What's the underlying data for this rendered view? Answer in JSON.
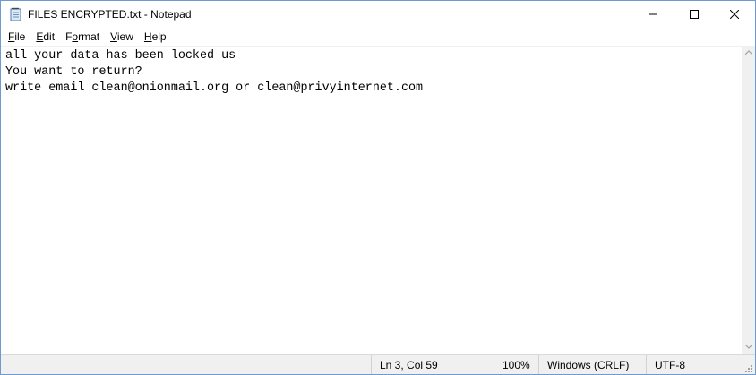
{
  "window": {
    "title": "FILES ENCRYPTED.txt - Notepad",
    "controls": {
      "minimize_icon": "minimize-icon",
      "maximize_icon": "maximize-icon",
      "close_icon": "close-icon"
    }
  },
  "menu": [
    {
      "accel": "F",
      "rest": "ile"
    },
    {
      "accel": "E",
      "rest": "dit"
    },
    {
      "accel": "F",
      "rest": "ormat",
      "accel_suffix": "o",
      "label": "Format"
    },
    {
      "accel": "V",
      "rest": "iew"
    },
    {
      "accel": "H",
      "rest": "elp"
    }
  ],
  "editor": {
    "lines": [
      "all your data has been locked us",
      "You want to return?",
      "write email clean@onionmail.org or clean@privyinternet.com"
    ]
  },
  "status": {
    "position": "Ln 3, Col 59",
    "zoom": "100%",
    "line_ending": "Windows (CRLF)",
    "encoding": "UTF-8"
  }
}
